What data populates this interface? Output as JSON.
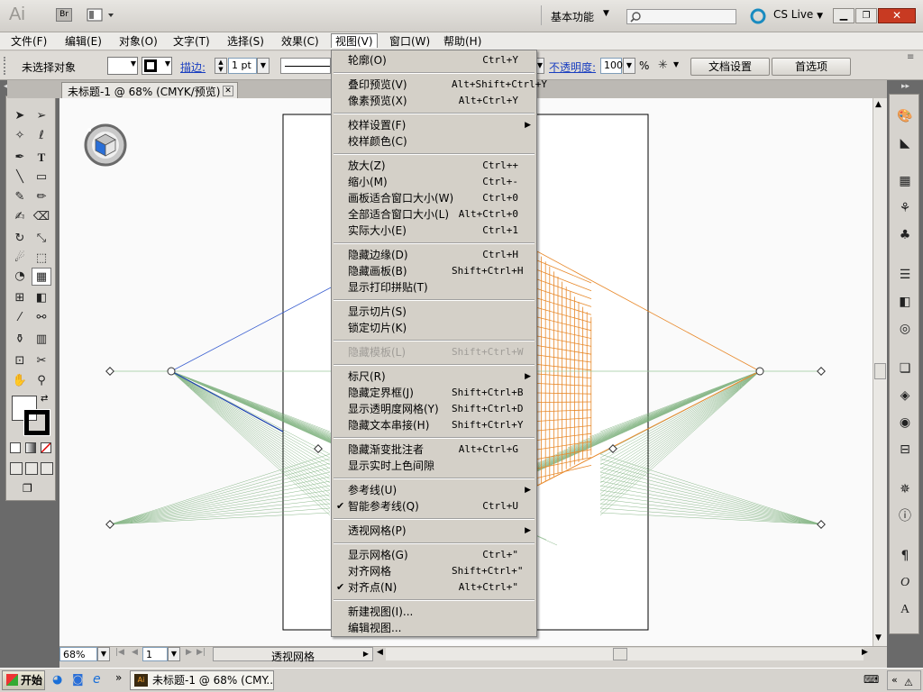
{
  "app": {
    "logo": "Ai",
    "bridge_label": "Br",
    "workspace": "基本功能",
    "cs_live": "CS Live"
  },
  "menubar": [
    "文件(F)",
    "编辑(E)",
    "对象(O)",
    "文字(T)",
    "选择(S)",
    "效果(C)",
    "视图(V)",
    "窗口(W)",
    "帮助(H)"
  ],
  "control": {
    "selection_status": "未选择对象",
    "stroke_label": "描边:",
    "stroke_value": "1 pt",
    "opacity_label": "不透明度:",
    "opacity_value": "100",
    "opacity_unit": "%",
    "doc_settings": "文档设置",
    "preferences": "首选项"
  },
  "document_tab": {
    "title": "未标题-1 @ 68% (CMYK/预览)"
  },
  "status": {
    "zoom": "68%",
    "artboard": "1",
    "tool_label": "透视网格"
  },
  "taskbar": {
    "start": "开始",
    "task": "未标题-1 @ 68% (CMY..."
  },
  "view_menu": {
    "items": [
      {
        "label": "轮廓(O)",
        "shortcut": "Ctrl+Y"
      },
      {
        "label": "叠印预览(V)",
        "shortcut": "Alt+Shift+Ctrl+Y"
      },
      {
        "label": "像素预览(X)",
        "shortcut": "Alt+Ctrl+Y"
      },
      {
        "label": "校样设置(F)",
        "shortcut": ""
      },
      {
        "label": "校样颜色(C)",
        "shortcut": ""
      },
      {
        "label": "放大(Z)",
        "shortcut": "Ctrl++"
      },
      {
        "label": "缩小(M)",
        "shortcut": "Ctrl+-"
      },
      {
        "label": "画板适合窗口大小(W)",
        "shortcut": "Ctrl+0"
      },
      {
        "label": "全部适合窗口大小(L)",
        "shortcut": "Alt+Ctrl+0"
      },
      {
        "label": "实际大小(E)",
        "shortcut": "Ctrl+1"
      },
      {
        "label": "隐藏边缘(D)",
        "shortcut": "Ctrl+H"
      },
      {
        "label": "隐藏画板(B)",
        "shortcut": "Shift+Ctrl+H"
      },
      {
        "label": "显示打印拼贴(T)",
        "shortcut": ""
      },
      {
        "label": "显示切片(S)",
        "shortcut": ""
      },
      {
        "label": "锁定切片(K)",
        "shortcut": ""
      },
      {
        "label": "隐藏模板(L)",
        "shortcut": "Shift+Ctrl+W"
      },
      {
        "label": "标尺(R)",
        "shortcut": ""
      },
      {
        "label": "隐藏定界框(J)",
        "shortcut": "Shift+Ctrl+B"
      },
      {
        "label": "显示透明度网格(Y)",
        "shortcut": "Shift+Ctrl+D"
      },
      {
        "label": "隐藏文本串接(H)",
        "shortcut": "Shift+Ctrl+Y"
      },
      {
        "label": "隐藏渐变批注者",
        "shortcut": "Alt+Ctrl+G"
      },
      {
        "label": "显示实时上色间隙",
        "shortcut": ""
      },
      {
        "label": "参考线(U)",
        "shortcut": ""
      },
      {
        "label": "智能参考线(Q)",
        "shortcut": "Ctrl+U"
      },
      {
        "label": "透视网格(P)",
        "shortcut": ""
      },
      {
        "label": "显示网格(G)",
        "shortcut": "Ctrl+\""
      },
      {
        "label": "对齐网格",
        "shortcut": "Shift+Ctrl+\""
      },
      {
        "label": "对齐点(N)",
        "shortcut": "Alt+Ctrl+\""
      },
      {
        "label": "新建视图(I)...",
        "shortcut": ""
      },
      {
        "label": "编辑视图...",
        "shortcut": ""
      }
    ]
  }
}
